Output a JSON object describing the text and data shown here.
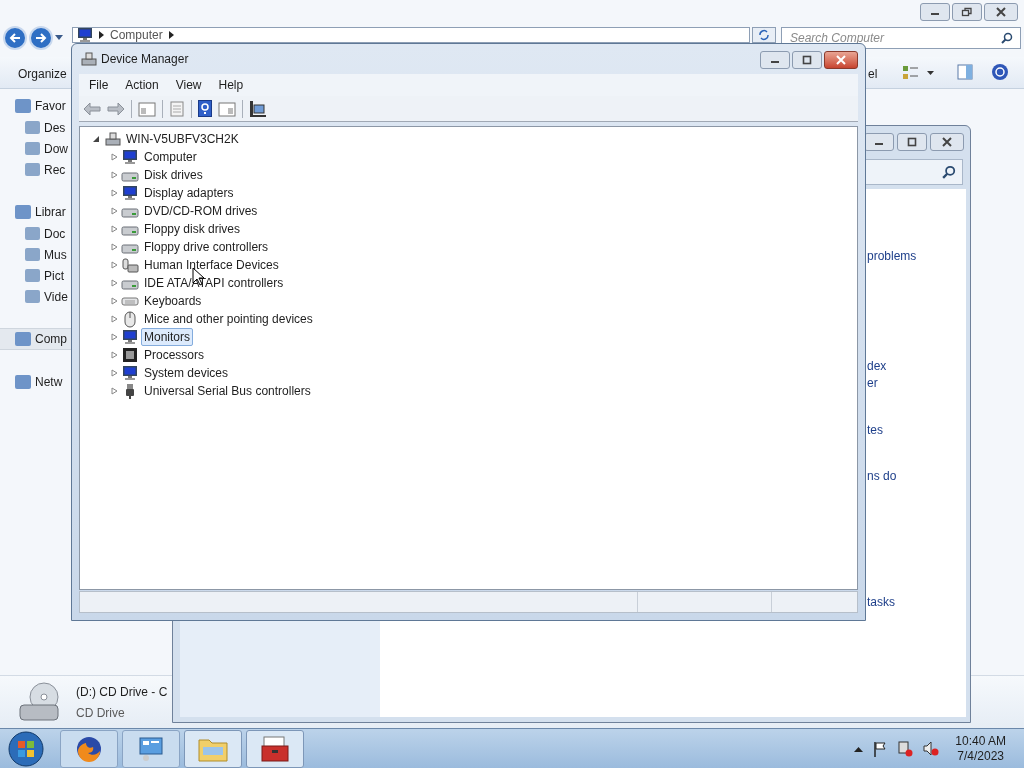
{
  "explorer": {
    "address": [
      "Computer"
    ],
    "search": {
      "placeholder": "Search Computer"
    },
    "toolbar": [
      "Organize",
      "el"
    ],
    "sidebar": [
      {
        "label": "Favor",
        "selected": false,
        "children": [
          {
            "label": "Des",
            "selected": false
          },
          {
            "label": "Dow",
            "selected": false
          },
          {
            "label": "Rec",
            "selected": false
          }
        ]
      },
      {
        "label": "Librar",
        "selected": false,
        "children": [
          {
            "label": "Doc",
            "selected": false
          },
          {
            "label": "Mus",
            "selected": false
          },
          {
            "label": "Pict",
            "selected": false
          },
          {
            "label": "Vide",
            "selected": false
          }
        ]
      },
      {
        "label": "Comp",
        "selected": true
      },
      {
        "label": "Netw",
        "selected": false
      }
    ],
    "details": {
      "title": "(D:) CD Drive - C",
      "subtitle": "CD Drive"
    }
  },
  "back_window": {
    "links": [
      "problems",
      "dex",
      "er",
      "tes",
      "ns do",
      "tasks"
    ]
  },
  "device_manager": {
    "title": "Device Manager",
    "menu": [
      "File",
      "Action",
      "View",
      "Help"
    ],
    "tree": {
      "label": "WIN-V5UBFV3CH2K",
      "expanded": true,
      "children": [
        {
          "label": "Computer",
          "expanded": false,
          "selected": false
        },
        {
          "label": "Disk drives",
          "expanded": false,
          "selected": false
        },
        {
          "label": "Display adapters",
          "expanded": false,
          "selected": false
        },
        {
          "label": "DVD/CD-ROM drives",
          "expanded": false,
          "selected": false
        },
        {
          "label": "Floppy disk drives",
          "expanded": false,
          "selected": false
        },
        {
          "label": "Floppy drive controllers",
          "expanded": false,
          "selected": false
        },
        {
          "label": "Human Interface Devices",
          "expanded": false,
          "selected": false
        },
        {
          "label": "IDE ATA/ATAPI controllers",
          "expanded": false,
          "selected": false
        },
        {
          "label": "Keyboards",
          "expanded": false,
          "selected": false
        },
        {
          "label": "Mice and other pointing devices",
          "expanded": false,
          "selected": false
        },
        {
          "label": "Monitors",
          "expanded": false,
          "selected": true
        },
        {
          "label": "Processors",
          "expanded": false,
          "selected": false
        },
        {
          "label": "System devices",
          "expanded": false,
          "selected": false
        },
        {
          "label": "Universal Serial Bus controllers",
          "expanded": false,
          "selected": false
        }
      ]
    }
  },
  "taskbar": {
    "time": "10:40 AM",
    "date": "7/4/2023"
  }
}
